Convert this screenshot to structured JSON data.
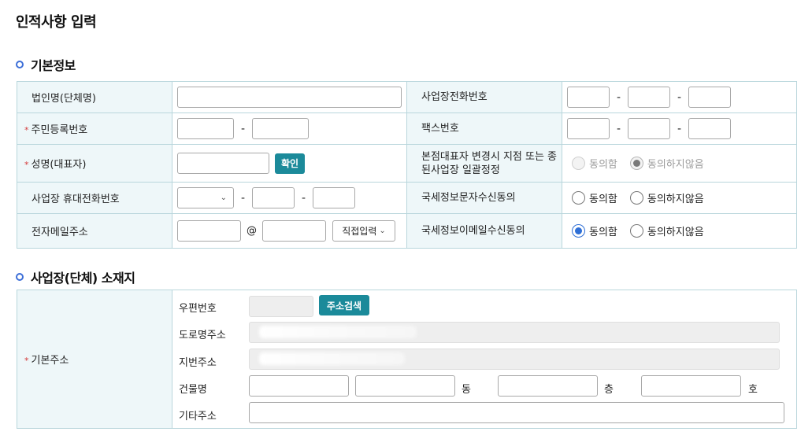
{
  "page": {
    "title": "인적사항 입력"
  },
  "sections": {
    "basic": "기본정보",
    "location": "사업장(단체) 소재지"
  },
  "basic": {
    "corp_name": "법인명(단체명)",
    "resident_no": "주민등록번호",
    "rep_name": "성명(대표자)",
    "confirm_button": "확인",
    "mobile": "사업장 휴대전화번호",
    "email": "전자메일주소",
    "email_at": "@",
    "email_domain_select": "직접입력",
    "biz_phone": "사업장전화번호",
    "fax": "팩스번호",
    "bulk_change": "본점대표자 변경시 지점 또는 종된사업장 일괄정정",
    "sms_consent": "국세정보문자수신동의",
    "email_consent": "국세정보이메일수신동의",
    "agree": "동의함",
    "disagree": "동의하지않음",
    "dash": "-"
  },
  "address": {
    "label": "기본주소",
    "zip_label": "우편번호",
    "search_button": "주소검색",
    "road_label": "도로명주소",
    "lot_label": "지번주소",
    "building_label": "건물명",
    "dong": "동",
    "floor": "층",
    "ho": "호",
    "other_label": "기타주소"
  },
  "radios": {
    "bulk_change_selected": "disagree",
    "sms_consent_selected": null,
    "email_consent_selected": "agree"
  },
  "colors": {
    "accent": "#1b8a9a",
    "header_bg": "#eef7f9",
    "border": "#b9d6dc",
    "radio_checked": "#2f6fd6",
    "required": "#d43a3a"
  }
}
